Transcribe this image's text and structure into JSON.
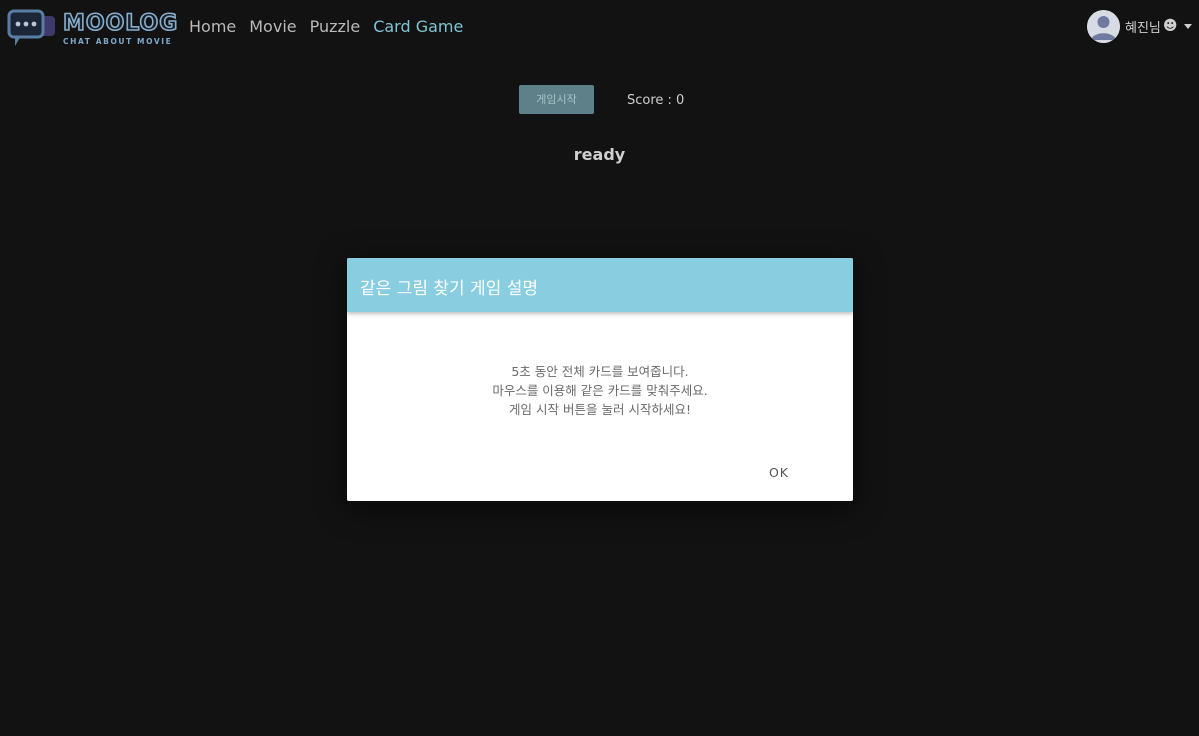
{
  "navbar": {
    "logo_text": "MOOLOG",
    "logo_tagline": "CHAT ABOUT MOVIE",
    "links": [
      {
        "label": "Home",
        "active": false
      },
      {
        "label": "Movie",
        "active": false
      },
      {
        "label": "Puzzle",
        "active": false
      },
      {
        "label": "Card Game",
        "active": true
      }
    ],
    "user": {
      "name": "혜진님",
      "emoji": "☻",
      "avatar_icon": "user-avatar-icon"
    }
  },
  "game": {
    "start_button_label": "게임시작",
    "score_label": "Score : 0",
    "status": "ready"
  },
  "dialog": {
    "title": "같은 그림 찾기 게임 설명",
    "lines": [
      "5초 동안 전체 카드를 보여줍니다.",
      "마우스를 이용해 같은 카드를 맞춰주세요.",
      "게임 시작 버튼을 눌러 시작하세요!"
    ],
    "ok_label": "OK"
  },
  "colors": {
    "background": "#121212",
    "accent": "#88cde0",
    "active_link": "#7fc4d6",
    "start_button": "#5d8089"
  }
}
